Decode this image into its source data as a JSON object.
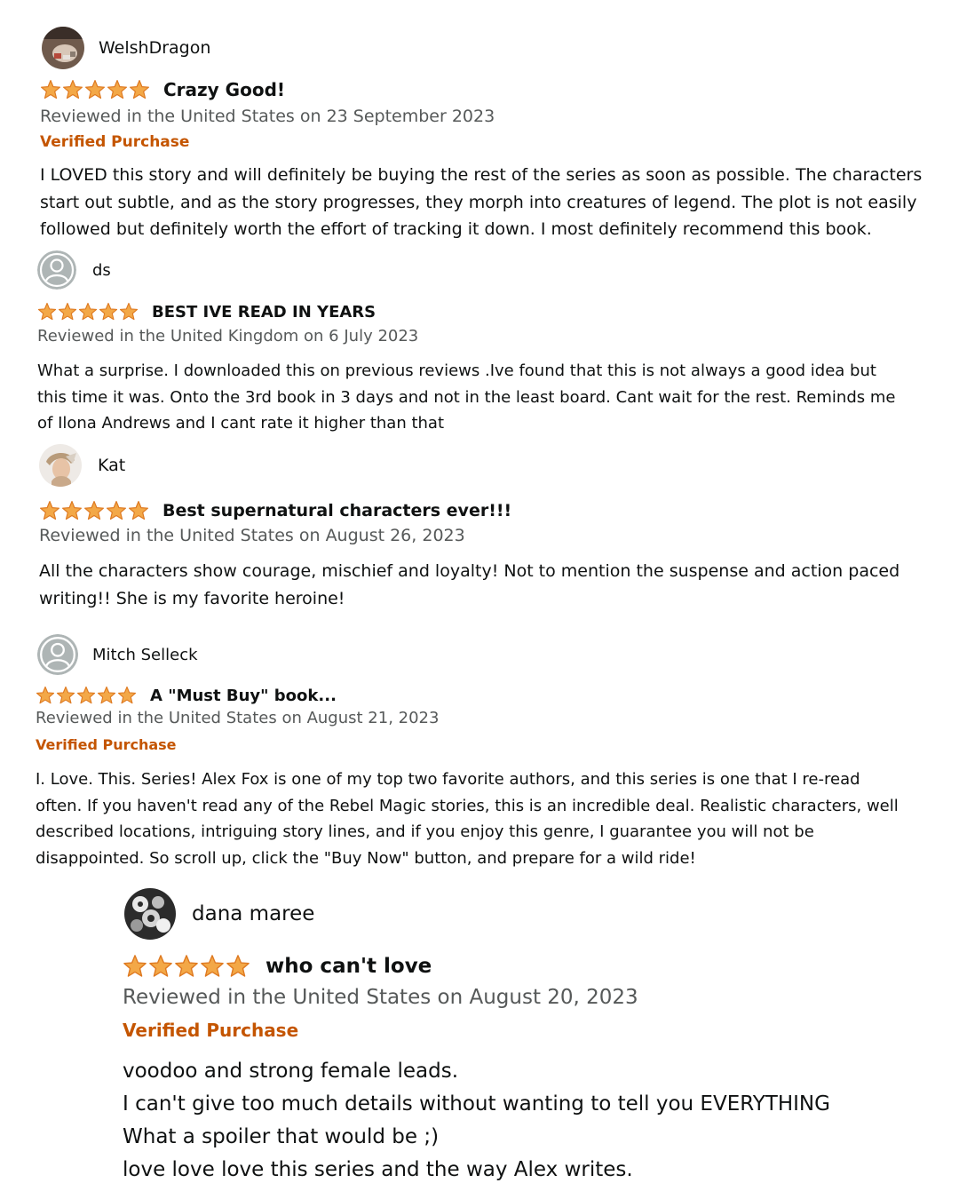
{
  "colors": {
    "star": "#f3a847",
    "star_stroke": "#de7921",
    "verified": "#c45500",
    "date": "#565959",
    "text": "#0f1111"
  },
  "reviews": [
    {
      "reviewer": "WelshDragon",
      "avatar_icon": "user-photo-avatar-icon",
      "rating": 5,
      "title": "Crazy Good!",
      "date": "Reviewed in the United States on 23 September 2023",
      "verified": "Verified Purchase",
      "body_lines": [
        "I LOVED this story and will definitely be buying the rest of the series as soon as possible. The characters",
        "start out subtle, and as the story progresses, they morph into creatures of legend. The plot is not easily",
        "followed but definitely worth the effort of tracking it down. I most definitely recommend this book."
      ]
    },
    {
      "reviewer": "ds",
      "avatar_icon": "default-profile-avatar-icon",
      "rating": 5,
      "title": "BEST IVE READ IN YEARS",
      "date": "Reviewed in the United Kingdom on 6 July 2023",
      "body_lines": [
        "What a surprise. I downloaded this on previous reviews .Ive found that this is not always a good idea but",
        "this time it was. Onto the 3rd book in 3 days and not in the least board. Cant wait for the rest. Reminds me",
        "of Ilona Andrews and I cant rate it higher than that"
      ]
    },
    {
      "reviewer": "Kat",
      "avatar_icon": "user-photo-avatar-icon",
      "rating": 5,
      "title": "Best supernatural characters ever!!!",
      "date": "Reviewed in the United States on August 26, 2023",
      "body_lines": [
        "All the characters show courage, mischief and loyalty! Not to mention the suspense and action paced",
        "writing!! She is my favorite heroine!"
      ]
    },
    {
      "reviewer": "Mitch Selleck",
      "avatar_icon": "default-profile-avatar-icon",
      "rating": 5,
      "title": "A \"Must Buy\" book...",
      "date": "Reviewed in the United States on August 21, 2023",
      "verified": "Verified Purchase",
      "body_lines": [
        "I. Love. This. Series! Alex Fox is one of my top two favorite authors, and this series is one that I re-read",
        "often. If you haven't read any of the Rebel Magic stories, this is an incredible deal. Realistic characters, well",
        "described locations, intriguing story lines, and if you enjoy this genre, I guarantee you will not be",
        "disappointed. So scroll up, click the \"Buy Now\" button, and prepare for a wild ride!"
      ]
    },
    {
      "reviewer": "dana maree",
      "avatar_icon": "user-photo-avatar-icon",
      "rating": 5,
      "title": "who can't love",
      "date": "Reviewed in the United States on August 20, 2023",
      "verified": "Verified Purchase",
      "body_lines": [
        "voodoo and strong female leads.",
        "I can't give too much details without wanting to tell you EVERYTHING",
        "What a spoiler that would be ;)",
        "love love love this series and the way Alex writes."
      ]
    }
  ]
}
